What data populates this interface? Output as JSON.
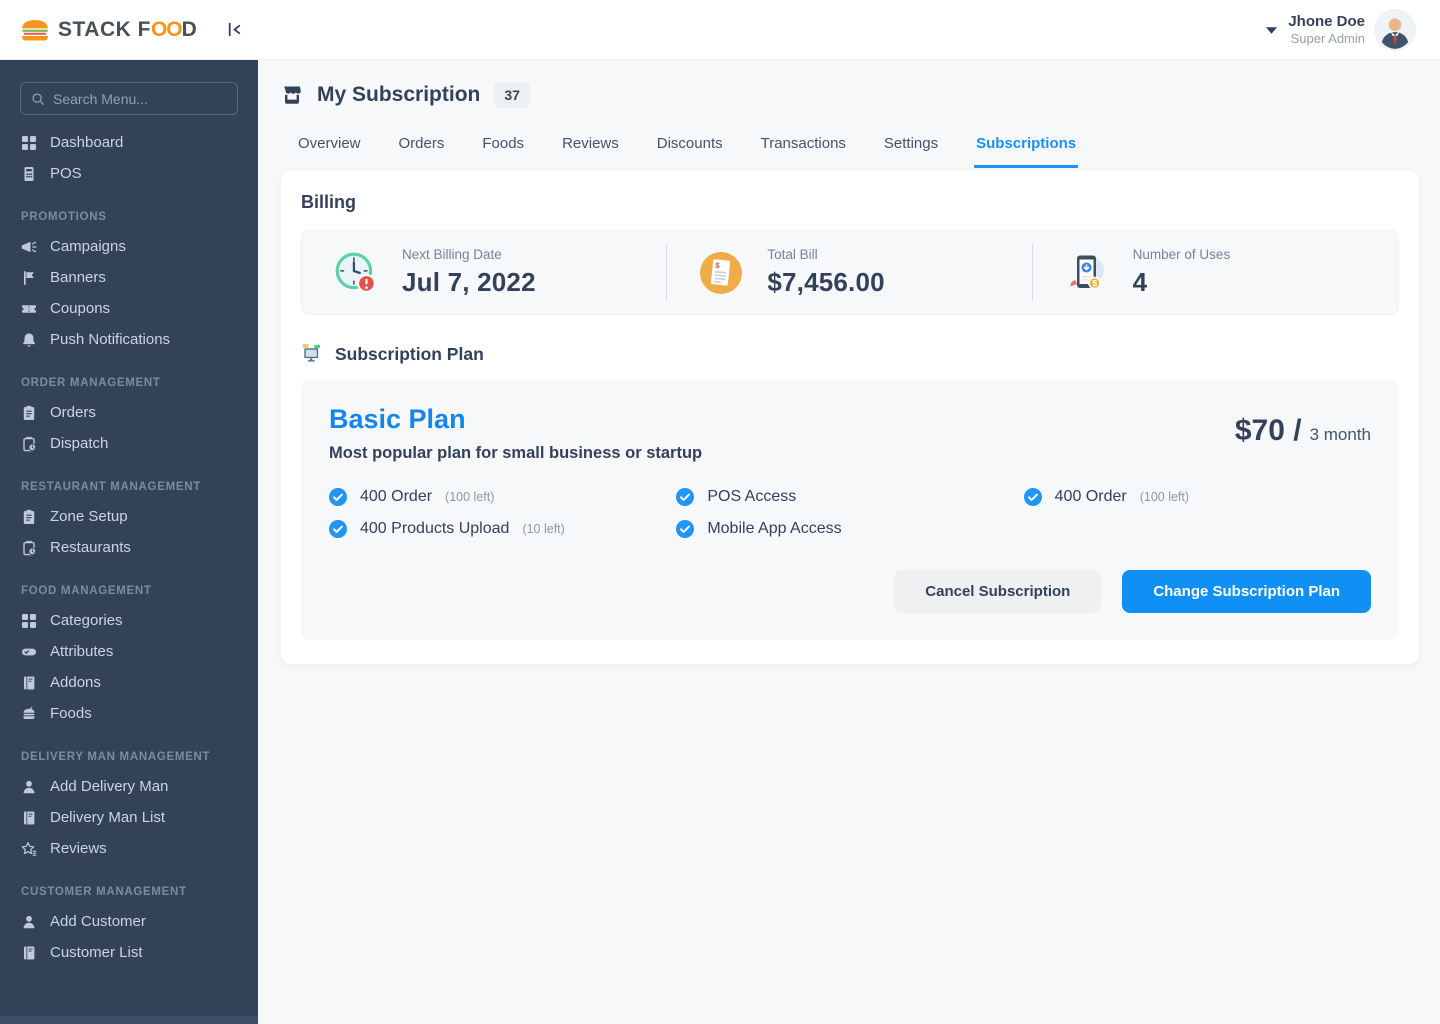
{
  "brand": {
    "text_dark_1": "STACK F",
    "text_orange": "OO",
    "text_dark_2": "D",
    "logo_icon": "burger-logo"
  },
  "colors": {
    "accent_blue": "#1b90f5",
    "sidebar_bg": "#334257",
    "brand_orange": "#f7941e",
    "success_green": "#5ad2a2",
    "alert_red": "#e8504a",
    "bill_orange": "#efac49",
    "coin_yellow": "#f3b33b"
  },
  "header": {
    "user_name": "Jhone Doe",
    "user_role": "Super Admin",
    "caret_icon": "caret-down",
    "avatar_icon": "businessman-avatar"
  },
  "sidebar": {
    "search_placeholder": "Search Menu...",
    "search_icon": "search",
    "top_items": [
      {
        "label": "Dashboard",
        "icon": "grid"
      },
      {
        "label": "POS",
        "icon": "pos"
      }
    ],
    "sections": [
      {
        "title": "PROMOTIONS",
        "items": [
          {
            "label": "Campaigns",
            "icon": "megaphone"
          },
          {
            "label": "Banners",
            "icon": "flag"
          },
          {
            "label": "Coupons",
            "icon": "ticket"
          },
          {
            "label": "Push Notifications",
            "icon": "bell"
          }
        ]
      },
      {
        "title": "ORDER MANAGEMENT",
        "items": [
          {
            "label": "Orders",
            "icon": "clipboard"
          },
          {
            "label": "Dispatch",
            "icon": "clipboard-clock"
          }
        ]
      },
      {
        "title": "RESTAURANT MANAGEMENT",
        "items": [
          {
            "label": "Zone Setup",
            "icon": "clipboard"
          },
          {
            "label": "Restaurants",
            "icon": "clipboard-clock"
          }
        ]
      },
      {
        "title": "FOOD MANAGEMENT",
        "items": [
          {
            "label": "Categories",
            "icon": "grid"
          },
          {
            "label": "Attributes",
            "icon": "toggle"
          },
          {
            "label": "Addons",
            "icon": "book"
          },
          {
            "label": "Foods",
            "icon": "burger"
          }
        ]
      },
      {
        "title": "DELIVERY MAN MANAGEMENT",
        "items": [
          {
            "label": "Add Delivery Man",
            "icon": "person"
          },
          {
            "label": "Delivery Man List",
            "icon": "book"
          },
          {
            "label": "Reviews",
            "icon": "star"
          }
        ]
      },
      {
        "title": "CUSTOMER MANAGEMENT",
        "items": [
          {
            "label": "Add Customer",
            "icon": "person"
          },
          {
            "label": "Customer List",
            "icon": "book"
          }
        ]
      }
    ]
  },
  "page": {
    "title": "My Subscription",
    "badge": "37",
    "title_icon": "storefront"
  },
  "tabs": [
    {
      "label": "Overview",
      "active": false
    },
    {
      "label": "Orders",
      "active": false
    },
    {
      "label": "Foods",
      "active": false
    },
    {
      "label": "Reviews",
      "active": false
    },
    {
      "label": "Discounts",
      "active": false
    },
    {
      "label": "Transactions",
      "active": false
    },
    {
      "label": "Settings",
      "active": false
    },
    {
      "label": "Subscriptions",
      "active": true
    }
  ],
  "billing": {
    "heading": "Billing",
    "stats": [
      {
        "icon": "clock-alert",
        "label": "Next Billing Date",
        "value": "Jul 7, 2022"
      },
      {
        "icon": "bill",
        "label": "Total Bill",
        "value": "$7,456.00"
      },
      {
        "icon": "phone-dollar",
        "label": "Number of Uses",
        "value": "4"
      }
    ]
  },
  "subscription": {
    "heading": "Subscription Plan",
    "heading_icon": "monitor-chat",
    "plan_name": "Basic Plan",
    "plan_desc": "Most popular plan for small business or startup",
    "price": "$70 /",
    "period": "3 month",
    "features": [
      {
        "text": "400 Order",
        "note": "(100 left)"
      },
      {
        "text": "400 Products Upload",
        "note": "(10 left)"
      },
      {
        "text": "POS Access",
        "note": ""
      },
      {
        "text": "Mobile App Access",
        "note": ""
      },
      {
        "text": "400 Order",
        "note": "(100 left)"
      }
    ],
    "cancel_label": "Cancel Subscription",
    "change_label": "Change Subscription Plan"
  }
}
